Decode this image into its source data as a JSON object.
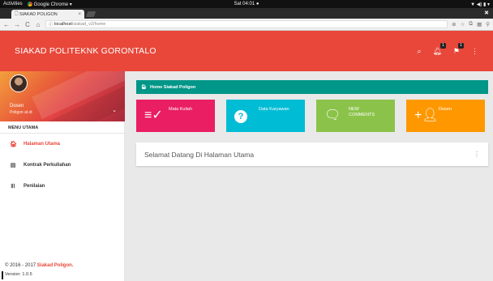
{
  "os": {
    "activities": "Activities",
    "app": "Google Chrome ▾",
    "clock": "Sat 04:01 ●",
    "tray": "▼ ◀) ▮ ▾"
  },
  "browser": {
    "tab_title": "SIAKAD POLIGON",
    "tab_close": "×",
    "url_host": "localhost",
    "url_path": "/siakad_v2/home",
    "back": "←",
    "forward": "→",
    "reload": "C",
    "home": "⌂"
  },
  "header": {
    "title": "SIAKAD POLITEKNK GORONTALO",
    "notifications_count": "1",
    "flags_count": "1"
  },
  "user": {
    "name": "Dosen",
    "email": "Poligon at.id"
  },
  "menu": {
    "header": "MENU UTAMA",
    "items": [
      {
        "label": "Halaman Utama",
        "icon": "home-icon",
        "active": true
      },
      {
        "label": "Kontrak Perkuliahan",
        "icon": "list-icon",
        "active": false
      },
      {
        "label": "Penilaian",
        "icon": "bars-icon",
        "active": false
      }
    ]
  },
  "footer": {
    "copyright": "© 2016 - 2017",
    "brand": "Siakad Poligon.",
    "version": "Version: 1.0.5"
  },
  "main": {
    "breadcrumb": "Home Siakad Poligon",
    "tiles": [
      {
        "label": "Mata Kuliah",
        "color": "#e91e63",
        "icon": "playlist-check-icon"
      },
      {
        "label": "Data Karyawan",
        "color": "#00bcd4",
        "icon": "help-icon"
      },
      {
        "label": "NEW COMMENTS",
        "color": "#8bc34a",
        "icon": "comment-icon"
      },
      {
        "label": "Dosen",
        "color": "#ff9800",
        "icon": "person-add-icon"
      }
    ],
    "welcome": "Selamat Datang Di Halaman Utama"
  },
  "colors": {
    "header": "#e8473a",
    "breadcrumb": "#009688"
  }
}
